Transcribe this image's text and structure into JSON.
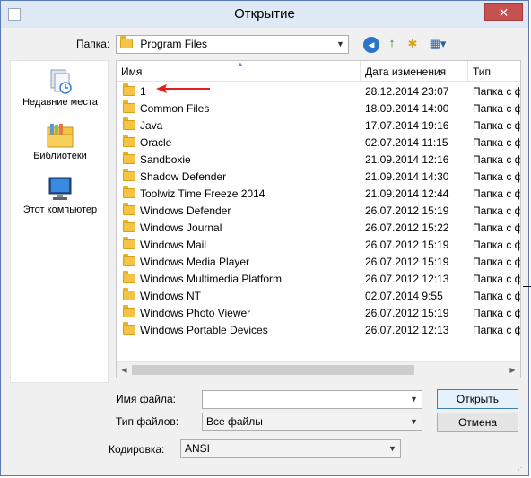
{
  "window": {
    "title": "Открытие",
    "close_glyph": "✕"
  },
  "lookin": {
    "label": "Папка:",
    "value": "Program Files"
  },
  "toolbar": {
    "back_glyph": "◀",
    "up_glyph": "↑",
    "newfolder_glyph": "✱",
    "views_glyph": "▦▾"
  },
  "places": [
    {
      "label": "Недавние места",
      "icon": "recent-places-icon"
    },
    {
      "label": "Библиотеки",
      "icon": "libraries-icon"
    },
    {
      "label": "Этот компьютер",
      "icon": "computer-icon"
    }
  ],
  "columns": {
    "name": "Имя",
    "date": "Дата изменения",
    "type": "Тип"
  },
  "files": [
    {
      "name": "1",
      "date": "28.12.2014 23:07",
      "type": "Папка с ф"
    },
    {
      "name": "Common Files",
      "date": "18.09.2014 14:00",
      "type": "Папка с ф"
    },
    {
      "name": "Java",
      "date": "17.07.2014 19:16",
      "type": "Папка с ф"
    },
    {
      "name": "Oracle",
      "date": "02.07.2014 11:15",
      "type": "Папка с ф"
    },
    {
      "name": "Sandboxie",
      "date": "21.09.2014 12:16",
      "type": "Папка с ф"
    },
    {
      "name": "Shadow Defender",
      "date": "21.09.2014 14:30",
      "type": "Папка с ф"
    },
    {
      "name": "Toolwiz Time Freeze 2014",
      "date": "21.09.2014 12:44",
      "type": "Папка с ф"
    },
    {
      "name": "Windows Defender",
      "date": "26.07.2012 15:19",
      "type": "Папка с ф"
    },
    {
      "name": "Windows Journal",
      "date": "26.07.2012 15:22",
      "type": "Папка с ф"
    },
    {
      "name": "Windows Mail",
      "date": "26.07.2012 15:19",
      "type": "Папка с ф"
    },
    {
      "name": "Windows Media Player",
      "date": "26.07.2012 15:19",
      "type": "Папка с ф"
    },
    {
      "name": "Windows Multimedia Platform",
      "date": "26.07.2012 12:13",
      "type": "Папка с ф"
    },
    {
      "name": "Windows NT",
      "date": "02.07.2014 9:55",
      "type": "Папка с ф"
    },
    {
      "name": "Windows Photo Viewer",
      "date": "26.07.2012 15:19",
      "type": "Папка с ф"
    },
    {
      "name": "Windows Portable Devices",
      "date": "26.07.2012 12:13",
      "type": "Папка с ф"
    }
  ],
  "filename": {
    "label": "Имя файла:",
    "value": ""
  },
  "filetype": {
    "label": "Тип файлов:",
    "value": "Все файлы"
  },
  "encoding": {
    "label": "Кодировка:",
    "value": "ANSI"
  },
  "buttons": {
    "open": "Открыть",
    "cancel": "Отмена"
  },
  "colors": {
    "annotation_arrow": "#e02020",
    "folder": "#f5c442"
  }
}
